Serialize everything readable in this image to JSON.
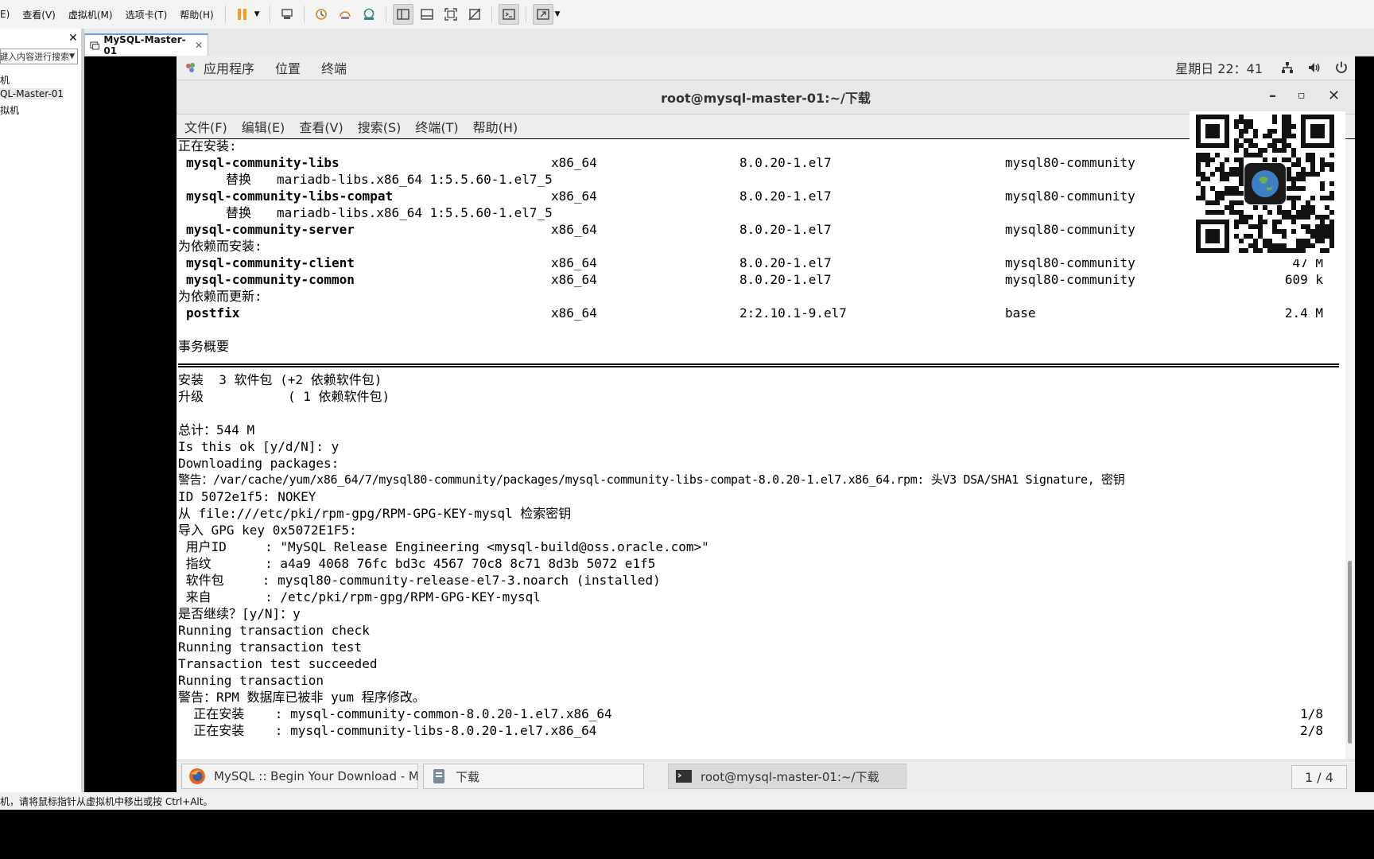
{
  "host": {
    "menu": [
      "E)",
      "查看(V)",
      "虚拟机(M)",
      "选项卡(T)",
      "帮助(H)"
    ],
    "sidebar": {
      "search_placeholder": "在此处键入内容进行搜索",
      "items": [
        "机",
        "QL-Master-01",
        "拟机"
      ]
    },
    "tab": {
      "label": "MySQL-Master-01"
    },
    "status": "机，请将鼠标指针从虚拟机中移出或按 Ctrl+Alt。"
  },
  "gnome": {
    "topbar": {
      "apps": "应用程序",
      "places": "位置",
      "terminal": "终端",
      "clock": "星期日 22：41"
    },
    "window_title": "root@mysql-master-01:~/下载",
    "term_menu": [
      "文件(F)",
      "编辑(E)",
      "查看(V)",
      "搜索(S)",
      "终端(T)",
      "帮助(H)"
    ],
    "taskbar": {
      "tasks": [
        "MySQL :: Begin Your Download - M…",
        "下载",
        "root@mysql-master-01:~/下载"
      ],
      "pager": "1 / 4"
    }
  },
  "terminal": {
    "header_installing": "正在安装:",
    "replace_label": "替换",
    "rows": [
      {
        "name": "mysql-community-libs",
        "arch": "x86_64",
        "ver": "8.0.20-1.el7",
        "repo": "mysql80-community",
        "size": ""
      },
      {
        "name": "mysql-community-libs-compat",
        "arch": "x86_64",
        "ver": "8.0.20-1.el7",
        "repo": "mysql80-community",
        "size": ""
      },
      {
        "name": "mysql-community-server",
        "arch": "x86_64",
        "ver": "8.0.20-1.el7",
        "repo": "mysql80-community",
        "size": ""
      },
      {
        "name": "mysql-community-client",
        "arch": "x86_64",
        "ver": "8.0.20-1.el7",
        "repo": "mysql80-community",
        "size": "47 M"
      },
      {
        "name": "mysql-community-common",
        "arch": "x86_64",
        "ver": "8.0.20-1.el7",
        "repo": "mysql80-community",
        "size": "609 k"
      },
      {
        "name": "postfix",
        "arch": "x86_64",
        "ver": "2:2.10.1-9.el7",
        "repo": "base",
        "size": "2.4 M"
      }
    ],
    "replaces": [
      "mariadb-libs.x86_64 1:5.5.60-1.el7_5",
      "mariadb-libs.x86_64 1:5.5.60-1.el7_5"
    ],
    "header_deps_install": "为依赖而安装:",
    "header_deps_update": "为依赖而更新:",
    "summary_title": "事务概要",
    "lines": [
      "安装  3 软件包 (+2 依赖软件包)",
      "升级           ( 1 依赖软件包)",
      "",
      "总计：544 M",
      "Is this ok [y/d/N]: y",
      "Downloading packages:",
      "警告：/var/cache/yum/x86_64/7/mysql80-community/packages/mysql-community-libs-compat-8.0.20-1.el7.x86_64.rpm: 头V3 DSA/SHA1 Signature, 密钥",
      "ID 5072e1f5: NOKEY",
      "从 file:///etc/pki/rpm-gpg/RPM-GPG-KEY-mysql 检索密钥",
      "导入 GPG key 0x5072E1F5:",
      " 用户ID     : \"MySQL Release Engineering <mysql-build@oss.oracle.com>\"",
      " 指纹       : a4a9 4068 76fc bd3c 4567 70c8 8c71 8d3b 5072 e1f5",
      " 软件包     : mysql80-community-release-el7-3.noarch (installed)",
      " 来自       : /etc/pki/rpm-gpg/RPM-GPG-KEY-mysql",
      "是否继续？[y/N]：y",
      "Running transaction check",
      "Running transaction test",
      "Transaction test succeeded",
      "Running transaction",
      "警告：RPM 数据库已被非 yum 程序修改。"
    ],
    "progress": [
      {
        "label": "  正在安装    : mysql-community-common-8.0.20-1.el7.x86_64",
        "count": "1/8"
      },
      {
        "label": "  正在安装    : mysql-community-libs-8.0.20-1.el7.x86_64",
        "count": "2/8"
      }
    ]
  }
}
